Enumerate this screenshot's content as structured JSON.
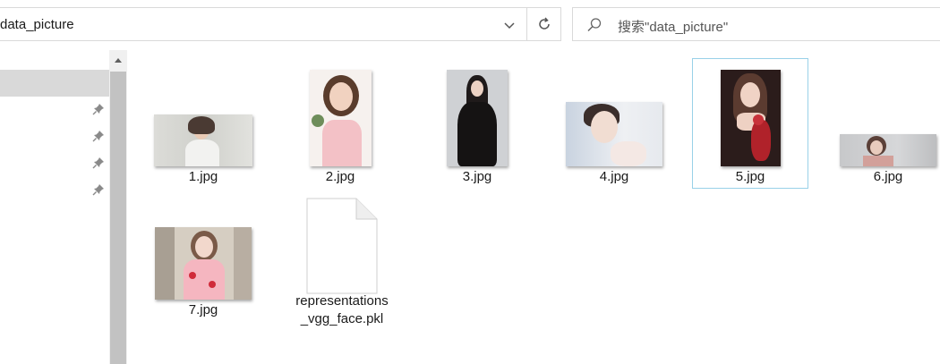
{
  "address_bar": {
    "path_text": "data_picture"
  },
  "search": {
    "placeholder": "搜索\"data_picture\""
  },
  "files": [
    {
      "name": "1.jpg",
      "type": "image",
      "selected": false
    },
    {
      "name": "2.jpg",
      "type": "image",
      "selected": false
    },
    {
      "name": "3.jpg",
      "type": "image",
      "selected": false
    },
    {
      "name": "4.jpg",
      "type": "image",
      "selected": false
    },
    {
      "name": "5.jpg",
      "type": "image",
      "selected": true
    },
    {
      "name": "6.jpg",
      "type": "image",
      "selected": false
    },
    {
      "name": "7.jpg",
      "type": "image",
      "selected": false
    },
    {
      "name": "representations\n_vgg_face.pkl",
      "name_line1": "representations",
      "name_line2": "_vgg_face.pkl",
      "type": "document",
      "selected": false
    }
  ],
  "colors": {
    "selection_border": "#99d1e8",
    "nav_selected": "#d9d9d9",
    "scroll_thumb": "#c2c2c2"
  },
  "icons": [
    "chevron-down-icon",
    "refresh-icon",
    "search-icon",
    "pin-icon",
    "scroll-up-icon",
    "document-icon"
  ]
}
